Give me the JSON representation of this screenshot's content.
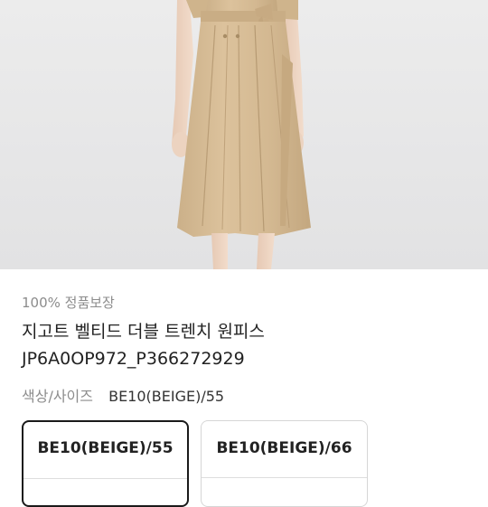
{
  "product": {
    "guarantee": "100% 정품보장",
    "name": "지고트 벨티드 더블 트렌치 원피스",
    "code": "JP6A0OP972_P366272929"
  },
  "option": {
    "label": "색상/사이즈",
    "selected_value": "BE10(BEIGE)/55"
  },
  "sizes": [
    {
      "label": "BE10(BEIGE)/55",
      "selected": true
    },
    {
      "label": "BE10(BEIGE)/66",
      "selected": false
    }
  ],
  "colors": {
    "dress": "#d6bb93",
    "background": "#e8e8e9",
    "selected_border": "#1a1a1a"
  }
}
